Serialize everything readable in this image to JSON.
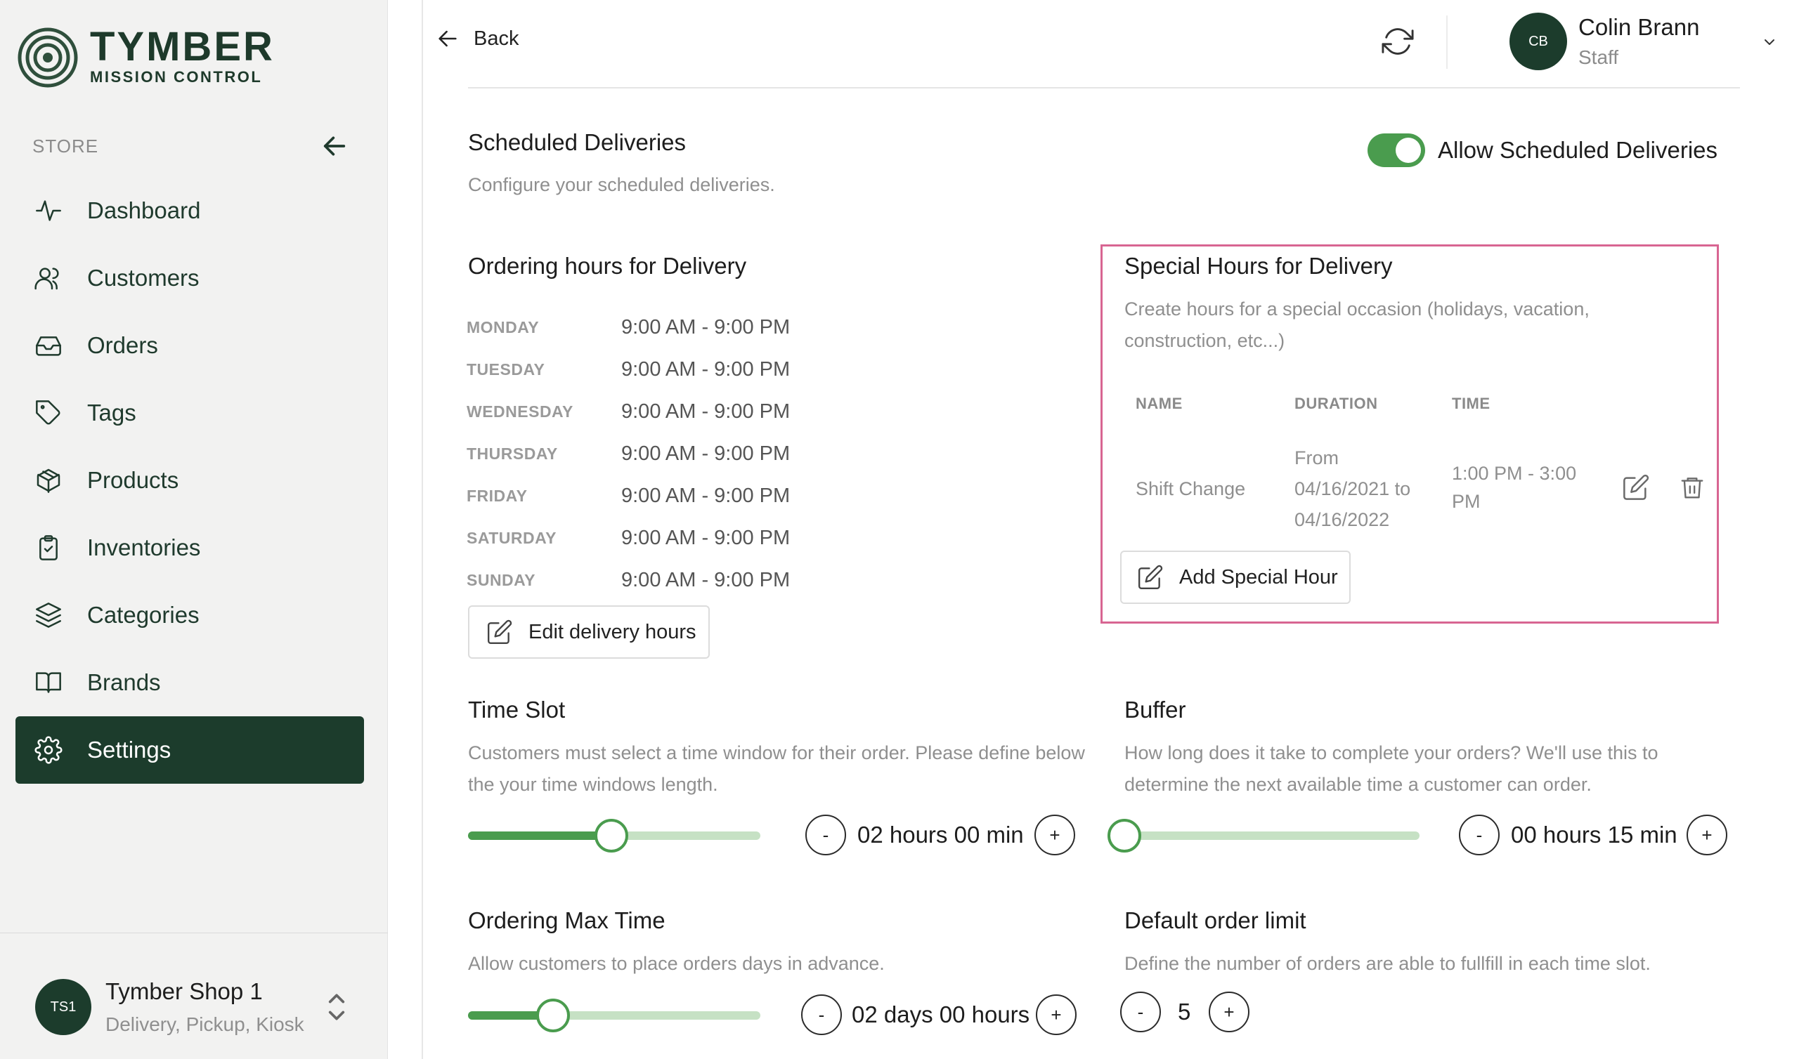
{
  "logo": {
    "title": "TYMBER",
    "subtitle": "MISSION CONTROL"
  },
  "sidebar": {
    "section_label": "STORE",
    "items": [
      {
        "label": "Dashboard",
        "icon": "activity-icon"
      },
      {
        "label": "Customers",
        "icon": "users-icon"
      },
      {
        "label": "Orders",
        "icon": "inbox-icon"
      },
      {
        "label": "Tags",
        "icon": "tag-icon"
      },
      {
        "label": "Products",
        "icon": "box-icon"
      },
      {
        "label": "Inventories",
        "icon": "clipboard-check-icon"
      },
      {
        "label": "Categories",
        "icon": "layers-icon"
      },
      {
        "label": "Brands",
        "icon": "book-open-icon"
      },
      {
        "label": "Settings",
        "icon": "gear-icon",
        "active": true
      }
    ],
    "shop": {
      "initials": "TS1",
      "name": "Tymber Shop 1",
      "types": "Delivery, Pickup, Kiosk"
    }
  },
  "header": {
    "back_label": "Back",
    "user": {
      "initials": "CB",
      "name": "Colin Brann",
      "role": "Staff"
    }
  },
  "scheduled": {
    "title": "Scheduled Deliveries",
    "description": "Configure your scheduled deliveries.",
    "toggle_label": "Allow Scheduled Deliveries",
    "toggle_on": true
  },
  "ordering_hours": {
    "title": "Ordering hours for Delivery",
    "days": [
      {
        "day": "MONDAY",
        "hours": "9:00 AM - 9:00 PM"
      },
      {
        "day": "TUESDAY",
        "hours": "9:00 AM - 9:00 PM"
      },
      {
        "day": "WEDNESDAY",
        "hours": "9:00 AM - 9:00 PM"
      },
      {
        "day": "THURSDAY",
        "hours": "9:00 AM - 9:00 PM"
      },
      {
        "day": "FRIDAY",
        "hours": "9:00 AM - 9:00 PM"
      },
      {
        "day": "SATURDAY",
        "hours": "9:00 AM - 9:00 PM"
      },
      {
        "day": "SUNDAY",
        "hours": "9:00 AM - 9:00 PM"
      }
    ],
    "edit_button": "Edit delivery hours"
  },
  "special_hours": {
    "title": "Special Hours for Delivery",
    "description": "Create hours for a special occasion (holidays, vacation, construction, etc...)",
    "columns": [
      "NAME",
      "DURATION",
      "TIME"
    ],
    "rows": [
      {
        "name": "Shift Change",
        "duration_line1": "From",
        "duration_line2": "04/16/2021 to",
        "duration_line3": "04/16/2022",
        "time_line1": "1:00 PM - 3:00",
        "time_line2": "PM"
      }
    ],
    "add_button": "Add Special Hour"
  },
  "time_slot": {
    "title": "Time Slot",
    "description": "Customers must select a time window for their order. Please define below the your time windows length.",
    "value": "02 hours 00 min",
    "slider_fraction": 0.49,
    "minus": "-",
    "plus": "+"
  },
  "buffer": {
    "title": "Buffer",
    "description": "How long does it take to complete your orders? We'll use this to determine the next available time a customer can order.",
    "value": "00 hours 15 min",
    "slider_fraction": 0.0,
    "minus": "-",
    "plus": "+"
  },
  "max_time": {
    "title": "Ordering Max Time",
    "description": "Allow customers to place orders days in advance.",
    "value": "02 days 00 hours",
    "slider_fraction": 0.29,
    "minus": "-",
    "plus": "+"
  },
  "order_limit": {
    "title": "Default order limit",
    "description": "Define the number of orders are able to fullfill in each time slot.",
    "value": "5",
    "minus": "-",
    "plus": "+"
  },
  "colors": {
    "brand": "#1c3c2c",
    "accent_green": "#4a9c4e",
    "highlight": "#d86592"
  }
}
